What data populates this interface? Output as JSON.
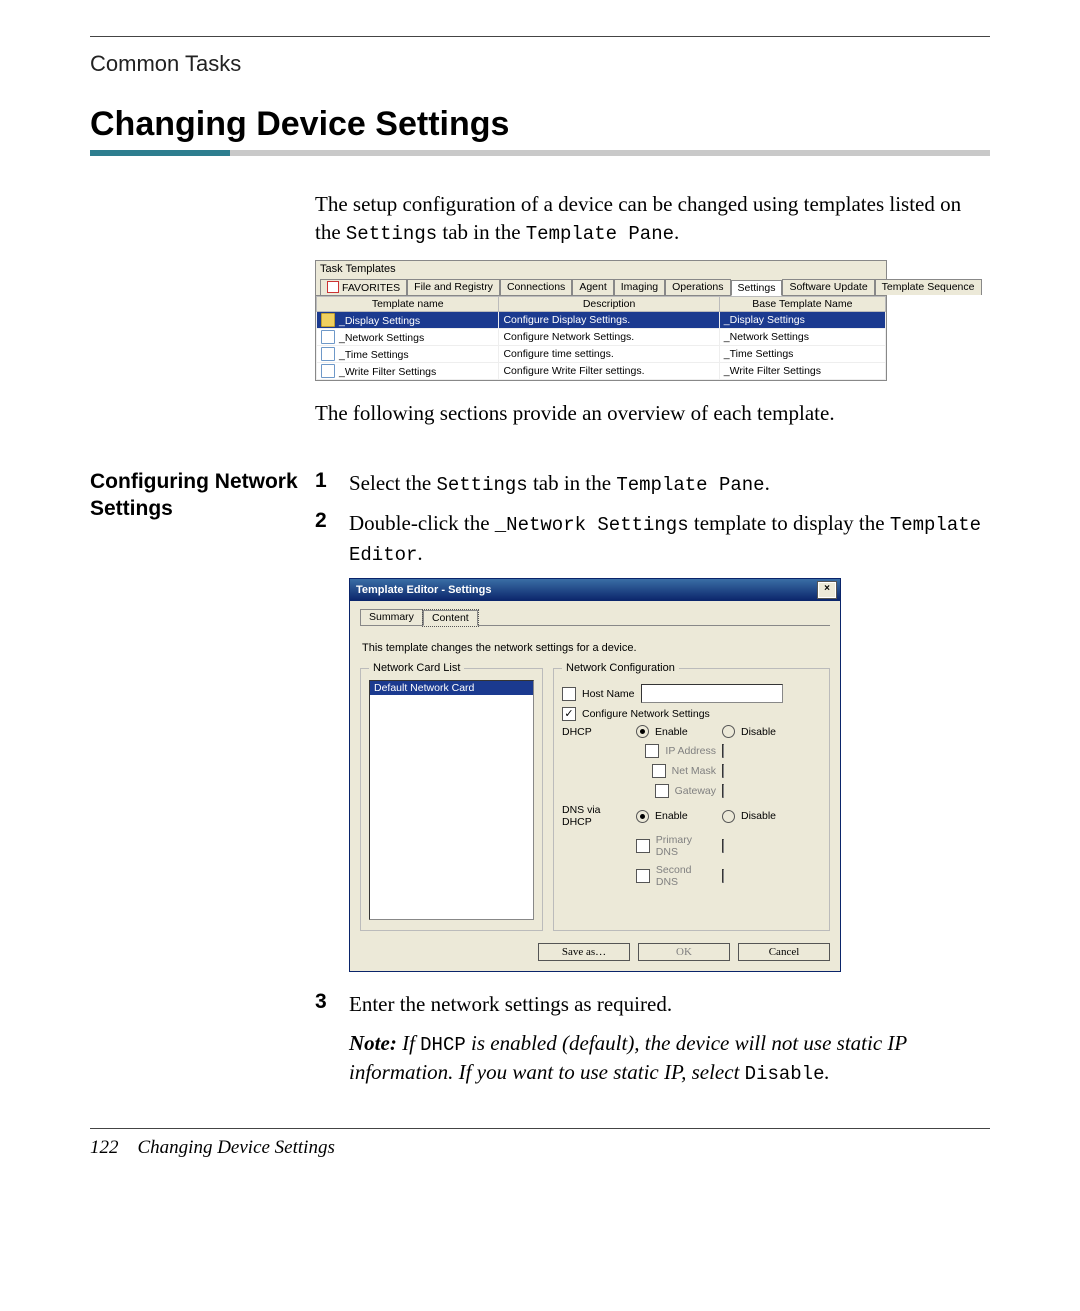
{
  "running_head": "Common Tasks",
  "title": "Changing Device Settings",
  "intro_a": "The setup configuration of a device can be changed using templates listed on the ",
  "intro_b": " tab in the ",
  "intro_settings": "Settings",
  "intro_pane": "Template Pane",
  "intro_end": ".",
  "after_table": "The following sections provide an overview of each template.",
  "side_heading": "Configuring Network Settings",
  "steps": {
    "n1": "1",
    "s1a": "Select the ",
    "s1b": " tab in the ",
    "s1_settings": "Settings",
    "s1_pane": "Template Pane",
    "s1_end": ".",
    "n2": "2",
    "s2a": "Double-click the ",
    "s2_tmpl": "_Network Settings",
    "s2b": " template to display the ",
    "s2_editor": "Template Editor",
    "s2_end": ".",
    "n3": "3",
    "s3": "Enter the network settings as required."
  },
  "ss1": {
    "title": "Task Templates",
    "tabs": [
      "FAVORITES",
      "File and Registry",
      "Connections",
      "Agent",
      "Imaging",
      "Operations",
      "Settings",
      "Software Update",
      "Template Sequence"
    ],
    "active_tab_index": 6,
    "headers": [
      "Template name",
      "Description",
      "Base Template Name"
    ],
    "rows": [
      {
        "name": "_Display Settings",
        "desc": "Configure Display Settings.",
        "base": "_Display Settings",
        "selected": true
      },
      {
        "name": "_Network Settings",
        "desc": "Configure Network Settings.",
        "base": "_Network Settings",
        "selected": false
      },
      {
        "name": "_Time Settings",
        "desc": "Configure time settings.",
        "base": "_Time Settings",
        "selected": false
      },
      {
        "name": "_Write Filter Settings",
        "desc": "Configure Write Filter settings.",
        "base": "_Write Filter Settings",
        "selected": false
      }
    ]
  },
  "ss2": {
    "title": "Template Editor - Settings",
    "close": "×",
    "tab_summary": "Summary",
    "tab_content": "Content",
    "desc": "This template changes the network settings for a device.",
    "ncl_legend": "Network Card List",
    "ncl_item": "Default Network Card",
    "ncfg_legend": "Network Configuration",
    "hostname_label": "Host Name",
    "config_label": "Configure Network Settings",
    "dhcp_label": "DHCP",
    "enable": "Enable",
    "disable": "Disable",
    "ip": "IP Address",
    "mask": "Net Mask",
    "gw": "Gateway",
    "dns_dhcp": "DNS via DHCP",
    "pdns": "Primary DNS",
    "sdns": "Second DNS",
    "saveas": "Save as…",
    "ok": "OK",
    "cancel": "Cancel"
  },
  "note": {
    "prefix": "Note:",
    "body_a": " If ",
    "dhcp": "DHCP",
    "body_b": " is enabled (default), the device will not use static IP information. If you want to use static IP, select ",
    "disable": "Disable",
    "end": "."
  },
  "footer": {
    "page": "122",
    "section": "Changing Device Settings"
  }
}
